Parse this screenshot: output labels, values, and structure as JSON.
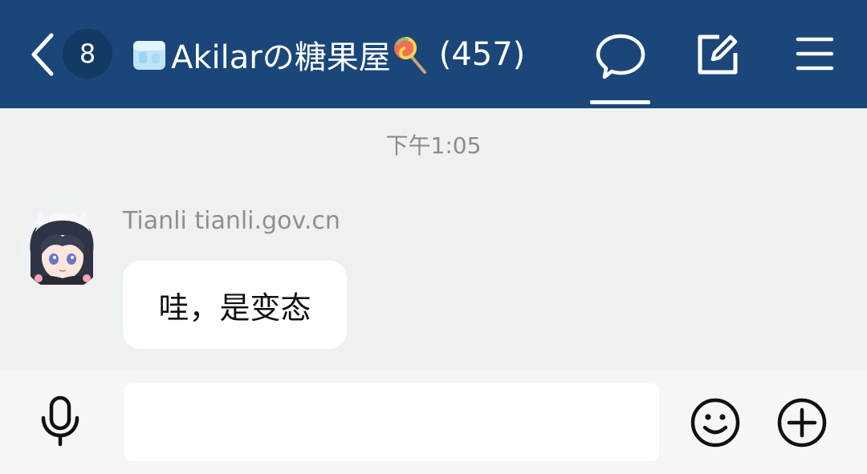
{
  "header": {
    "back_icon": "chevron-left-icon",
    "unread_count": "8",
    "title_prefix_icon": "ice-cube-emoji",
    "title_text": "Akilarの糖果屋",
    "title_suffix_icon": "lollipop-emoji",
    "member_count": "(457)",
    "icons": [
      "chat-bubble-icon",
      "edit-icon",
      "menu-icon"
    ],
    "background_color": "#1b4679"
  },
  "chat": {
    "timestamp": "下午1:05",
    "messages": [
      {
        "sender": "Tianli tianli.gov.cn",
        "avatar": "anime-avatar",
        "text": "哇，是变态"
      }
    ],
    "background_color": "#eef2ef"
  },
  "input_bar": {
    "mic_icon": "microphone-icon",
    "input_value": "",
    "placeholder": "",
    "emoji_icon": "emoji-smile-icon",
    "plus_icon": "plus-circle-icon"
  }
}
